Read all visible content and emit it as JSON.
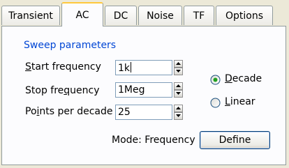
{
  "tabs": [
    {
      "label": "Transient",
      "active": false
    },
    {
      "label": "AC",
      "active": true
    },
    {
      "label": "DC",
      "active": false
    },
    {
      "label": "Noise",
      "active": false
    },
    {
      "label": "TF",
      "active": false
    },
    {
      "label": "Options",
      "active": false
    }
  ],
  "sweep": {
    "group_title": "Sweep parameters",
    "start_label_mnemonic": "S",
    "start_label_rest": "tart frequency",
    "start_value": "1k",
    "stop_label_pre": "Stop fre",
    "stop_label_mnemonic": "q",
    "stop_label_post": "uency",
    "stop_value": "1Meg",
    "points_label_pre": "Po",
    "points_label_mnemonic": "i",
    "points_label_post": "nts per decade",
    "points_value": "25"
  },
  "scale": {
    "decade_mnemonic": "D",
    "decade_rest": "ecade",
    "linear_mnemonic": "L",
    "linear_rest": "inear",
    "selected": "Decade"
  },
  "mode": {
    "label": "Mode: Frequency",
    "define_label": "Define"
  },
  "colors": {
    "accent_tab": "#ffc83c",
    "group_title": "#0046d5",
    "radio_selected": "#21a121"
  }
}
